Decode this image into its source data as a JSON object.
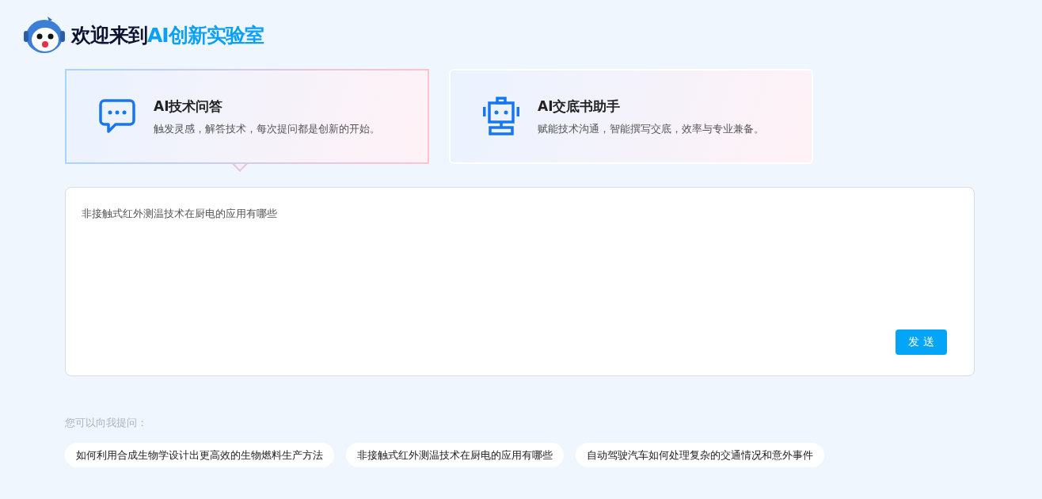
{
  "header": {
    "title_prefix": "欢迎来到",
    "title_highlight": "AI创新实验室"
  },
  "modes": [
    {
      "kind": "chat",
      "title": "AI技术问答",
      "description": "触发灵感，解答技术，每次提问都是创新的开始。",
      "selected": true
    },
    {
      "kind": "robot",
      "title": "AI交底书助手",
      "description": "赋能技术沟通，智能撰写交底，效率与专业兼备。",
      "selected": false
    }
  ],
  "input": {
    "value": "非接触式红外测温技术在厨电的应用有哪些",
    "send_label": "发 送"
  },
  "suggestions": {
    "label": "您可以向我提问：",
    "items": [
      "如何利用合成生物学设计出更高效的生物燃料生产方法",
      "非接触式红外测温技术在厨电的应用有哪些",
      "自动驾驶汽车如何处理复杂的交通情况和意外事件"
    ]
  }
}
